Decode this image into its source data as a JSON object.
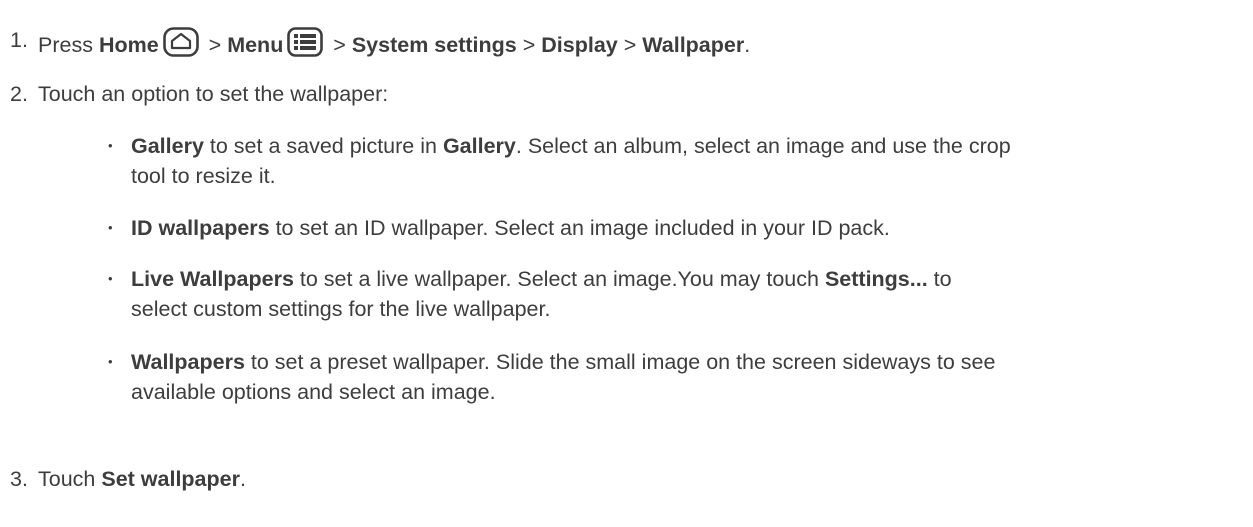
{
  "steps": [
    {
      "number": "1.",
      "press": "Press ",
      "home": "Home",
      "sep1": " > ",
      "menu": "Menu",
      "sep2": " > ",
      "system_settings": "System settings",
      "sep3": " > ",
      "display": "Display",
      "sep4": " > ",
      "wallpaper": "Wallpaper",
      "end": ".",
      "icons": [
        "home-icon",
        "menu-icon"
      ]
    },
    {
      "number": "2.",
      "text": "Touch an option to set the wallpaper:"
    },
    {
      "number": "3.",
      "touch": "Touch ",
      "set_wallpaper": "Set wallpaper",
      "end": "."
    }
  ],
  "options": [
    {
      "bullet": "•",
      "name": "Gallery",
      "text1": " to set a saved picture in ",
      "bold2": "Gallery",
      "text2a": ". Select an album, select an image and use the crop",
      "text2b": "tool to resize it."
    },
    {
      "bullet": "•",
      "name": "ID wallpapers",
      "text1": " to set an ID wallpaper. Select an image included in your ID pack."
    },
    {
      "bullet": "•",
      "name": "Live Wallpapers",
      "text1": " to set a live wallpaper. Select an image.You may touch ",
      "bold2": "Settings...",
      "text2a": " to",
      "text2b": "select custom settings for the live wallpaper."
    },
    {
      "bullet": "•",
      "name": "Wallpapers",
      "text1a": " to set a preset wallpaper. Slide the small image on the screen sideways to see",
      "text1b": "available options and select an image."
    }
  ]
}
